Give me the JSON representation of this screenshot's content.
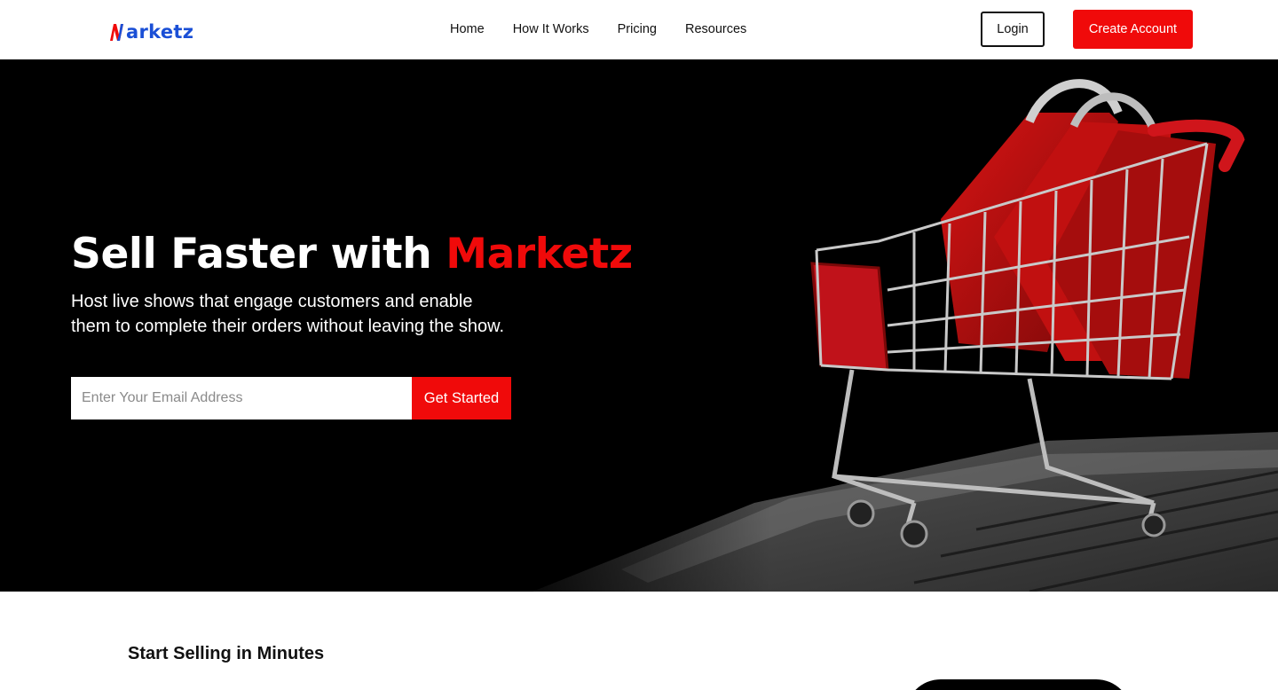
{
  "brand": {
    "name": "arketz",
    "colors": {
      "primary_blue": "#1a4fd6",
      "accent_red": "#f00a0a"
    }
  },
  "nav": {
    "links": [
      "Home",
      "How It Works",
      "Pricing",
      "Resources"
    ],
    "login_label": "Login",
    "create_account_label": "Create Account"
  },
  "hero": {
    "title_main": "Sell Faster with",
    "title_accent": "Marketz",
    "subtitle": "Host live shows that engage customers and enable them to complete their orders without leaving the show.",
    "email_placeholder": "Enter Your Email Address",
    "cta_label": "Get Started",
    "image_icon": "shopping-cart-on-laptop"
  },
  "section": {
    "title": "Start Selling in Minutes"
  }
}
